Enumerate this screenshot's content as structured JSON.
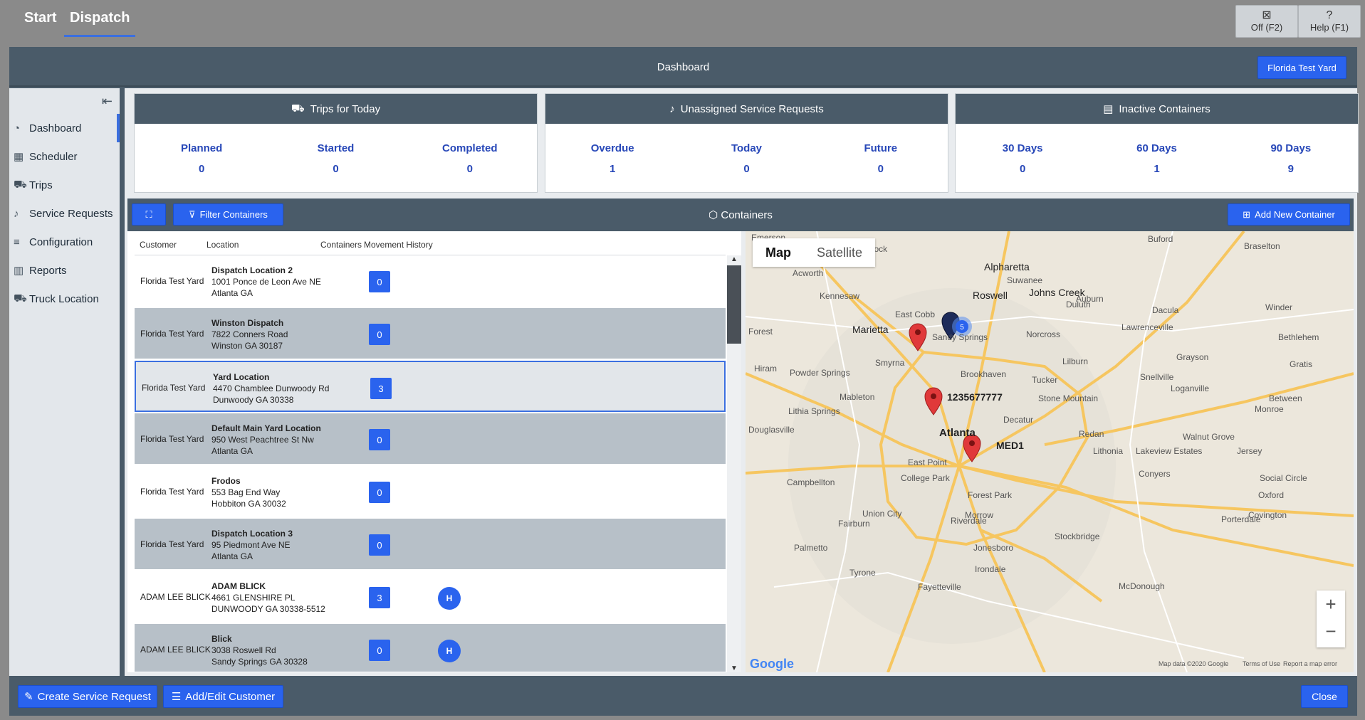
{
  "top": {
    "tabs": [
      {
        "label": "Start"
      },
      {
        "label": "Dispatch"
      }
    ],
    "off_label": "Off (F2)",
    "help_label": "Help (F1)"
  },
  "header": {
    "title": "Dashboard",
    "yard_button": "Florida Test Yard"
  },
  "sidebar": {
    "items": [
      {
        "label": "Dashboard",
        "icon": "chart-pie-icon"
      },
      {
        "label": "Scheduler",
        "icon": "calendar-icon"
      },
      {
        "label": "Trips",
        "icon": "truck-icon"
      },
      {
        "label": "Service Requests",
        "icon": "bell-icon"
      },
      {
        "label": "Configuration",
        "icon": "edit-list-icon"
      },
      {
        "label": "Reports",
        "icon": "bar-chart-icon"
      },
      {
        "label": "Truck Location",
        "icon": "truck-location-icon"
      }
    ]
  },
  "cards": [
    {
      "title": "Trips for Today",
      "stats": [
        {
          "label": "Planned",
          "value": "0"
        },
        {
          "label": "Started",
          "value": "0"
        },
        {
          "label": "Completed",
          "value": "0"
        }
      ]
    },
    {
      "title": "Unassigned Service Requests",
      "stats": [
        {
          "label": "Overdue",
          "value": "1"
        },
        {
          "label": "Today",
          "value": "0"
        },
        {
          "label": "Future",
          "value": "0"
        }
      ]
    },
    {
      "title": "Inactive Containers",
      "stats": [
        {
          "label": "30 Days",
          "value": "0"
        },
        {
          "label": "60 Days",
          "value": "1"
        },
        {
          "label": "90 Days",
          "value": "9"
        }
      ]
    }
  ],
  "containers": {
    "title": "Containers",
    "filter_label": "Filter Containers",
    "add_label": "Add New Container",
    "columns": [
      "Customer",
      "Location",
      "Containers",
      "Movement History"
    ],
    "rows": [
      {
        "customer": "Florida Test Yard",
        "name": "Dispatch Location 2",
        "addr1": "1001 Ponce de Leon Ave NE",
        "addr2": "Atlanta GA",
        "count": "0",
        "hist": ""
      },
      {
        "customer": "Florida Test Yard",
        "name": "Winston Dispatch",
        "addr1": "7822 Conners Road",
        "addr2": "Winston  GA 30187",
        "count": "0",
        "hist": ""
      },
      {
        "customer": "Florida Test Yard",
        "name": "Yard Location",
        "addr1": "4470 Chamblee Dunwoody Rd",
        "addr2": "Dunwoody GA 30338",
        "count": "3",
        "hist": ""
      },
      {
        "customer": "Florida Test Yard",
        "name": "Default Main Yard Location",
        "addr1": "950 West Peachtree St Nw",
        "addr2": "Atlanta GA",
        "count": "0",
        "hist": ""
      },
      {
        "customer": "Florida Test Yard",
        "name": "Frodos",
        "addr1": "553 Bag End Way",
        "addr2": "Hobbiton GA 30032",
        "count": "0",
        "hist": ""
      },
      {
        "customer": "Florida Test Yard",
        "name": "Dispatch Location 3",
        "addr1": "95 Piedmont Ave NE",
        "addr2": "Atlanta GA",
        "count": "0",
        "hist": ""
      },
      {
        "customer": "ADAM LEE BLICK",
        "name": "ADAM BLICK",
        "addr1": "4661 GLENSHIRE PL",
        "addr2": "DUNWOODY GA 30338-5512",
        "count": "3",
        "hist": "H"
      },
      {
        "customer": "ADAM LEE BLICK",
        "name": "Blick",
        "addr1": "3038 Roswell Rd",
        "addr2": "Sandy Springs GA 30328",
        "count": "0",
        "hist": "H"
      }
    ]
  },
  "map": {
    "tab_map": "Map",
    "tab_satellite": "Satellite",
    "cluster_count": "5",
    "marker_label_1": "1235677777",
    "marker_label_2": "MED1",
    "places": [
      "Emerson",
      "Woodstock",
      "Alpharetta",
      "Buford",
      "Braselton",
      "Acworth",
      "Kennesaw",
      "Roswell",
      "Johns Creek",
      "Suwanee",
      "Duluth",
      "Auburn",
      "Dacula",
      "Winder",
      "Marietta",
      "East Cobb",
      "Sandy Springs",
      "Norcross",
      "Lawrenceville",
      "Bethlehem",
      "Forest",
      "Smyrna",
      "Brookhaven",
      "Lilburn",
      "Grayson",
      "Gratis",
      "Hiram",
      "Powder Springs",
      "Tucker",
      "Snellville",
      "Loganville",
      "Mableton",
      "Stone Mountain",
      "Between",
      "Monroe",
      "Lithia Springs",
      "Decatur",
      "Douglasville",
      "Atlanta",
      "Redan",
      "Walnut Grove",
      "Lithonia",
      "Lakeview Estates",
      "Jersey",
      "East Point",
      "College Park",
      "Conyers",
      "Social Circle",
      "Campbellton",
      "Forest Park",
      "Oxford",
      "Union City",
      "Morrow",
      "Covington",
      "Porterdale",
      "Riverdale",
      "Fairburn",
      "Stockbridge",
      "Jonesboro",
      "Palmetto",
      "Irondale",
      "Tyrone",
      "Fayetteville",
      "McDonough"
    ],
    "attribution": "Map data ©2020 Google",
    "terms": "Terms of Use",
    "report": "Report a map error",
    "google": "Google"
  },
  "footer": {
    "create_label": "Create Service Request",
    "customer_label": "Add/Edit Customer",
    "close_label": "Close"
  },
  "colors": {
    "accent": "#2a63ee",
    "header": "#4a5b69",
    "row_alt": "#b7c0c8",
    "marker_red": "#e0393a"
  }
}
